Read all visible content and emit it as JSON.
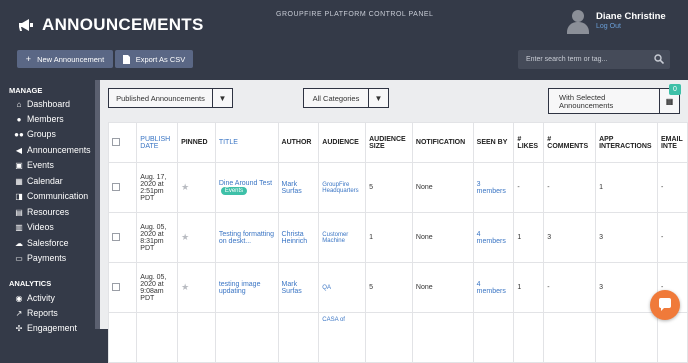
{
  "header": {
    "title": "ANNOUNCEMENTS",
    "platform_label": "GROUPFIRE PLATFORM CONTROL PANEL",
    "user_name": "Diane Christine",
    "logout_label": "Log Out",
    "new_button": "New Announcement",
    "export_button": "Export As CSV",
    "search_placeholder": "Enter search term or tag..."
  },
  "sidebar": {
    "manage_label": "MANAGE",
    "analytics_label": "ANALYTICS",
    "manage_items": [
      {
        "label": "Dashboard",
        "icon": "home-icon"
      },
      {
        "label": "Members",
        "icon": "user-icon"
      },
      {
        "label": "Groups",
        "icon": "users-icon"
      },
      {
        "label": "Announcements",
        "icon": "megaphone-icon"
      },
      {
        "label": "Events",
        "icon": "calendar-check-icon"
      },
      {
        "label": "Calendar",
        "icon": "calendar-icon"
      },
      {
        "label": "Communication",
        "icon": "chat-icon"
      },
      {
        "label": "Resources",
        "icon": "folder-icon"
      },
      {
        "label": "Videos",
        "icon": "film-icon"
      },
      {
        "label": "Salesforce",
        "icon": "cloud-icon"
      },
      {
        "label": "Payments",
        "icon": "credit-card-icon"
      }
    ],
    "analytics_items": [
      {
        "label": "Activity",
        "icon": "dashboard-icon"
      },
      {
        "label": "Reports",
        "icon": "line-chart-icon"
      },
      {
        "label": "Engagement",
        "icon": "engagement-icon"
      }
    ]
  },
  "filters": {
    "status": "Published Announcements",
    "category": "All Categories",
    "with_selected": "With Selected Announcements",
    "selected_count": "0"
  },
  "table": {
    "headers": {
      "publish_date": "PUBLISH DATE",
      "pinned": "PINNED",
      "title": "TITLE",
      "author": "AUTHOR",
      "audience": "AUDIENCE",
      "audience_size": "AUDIENCE SIZE",
      "notification": "NOTIFICATION",
      "seen_by": "SEEN BY",
      "likes": "# LIKES",
      "comments": "# COMMENTS",
      "app_interactions": "APP INTERACTIONS",
      "email": "EMAIL INTE"
    },
    "rows": [
      {
        "date": "Aug. 17, 2020 at 2:51pm PDT",
        "title": "Dine Around Test",
        "tag": "Events",
        "author": "Mark Surfas",
        "audience": "GroupFire Headquarters",
        "size": "5",
        "notification": "None",
        "seen_by": "3 members",
        "likes": "-",
        "comments": "-",
        "interactions": "1",
        "email": "-"
      },
      {
        "date": "Aug. 05, 2020 at 8:31pm PDT",
        "title": "Testing formatting on deskt...",
        "tag": "",
        "author": "Christa Heinrich",
        "audience": "Customer Machine",
        "size": "1",
        "notification": "None",
        "seen_by": "4 members",
        "likes": "1",
        "comments": "3",
        "interactions": "3",
        "email": "-"
      },
      {
        "date": "Aug. 05, 2020 at 9:08am PDT",
        "title": "testing image updating",
        "tag": "",
        "author": "Mark Surfas",
        "audience": "QA",
        "size": "5",
        "notification": "None",
        "seen_by": "4 members",
        "likes": "1",
        "comments": "-",
        "interactions": "3",
        "email": "-"
      },
      {
        "date": "",
        "title": "",
        "tag": "",
        "author": "",
        "audience": "CASA of",
        "size": "",
        "notification": "",
        "seen_by": "",
        "likes": "",
        "comments": "",
        "interactions": "",
        "email": ""
      }
    ]
  },
  "colors": {
    "background": "#343a48",
    "button": "#5a6785",
    "link": "#3a75c4",
    "accent": "#3ec0a8",
    "chat": "#f07a3a"
  }
}
